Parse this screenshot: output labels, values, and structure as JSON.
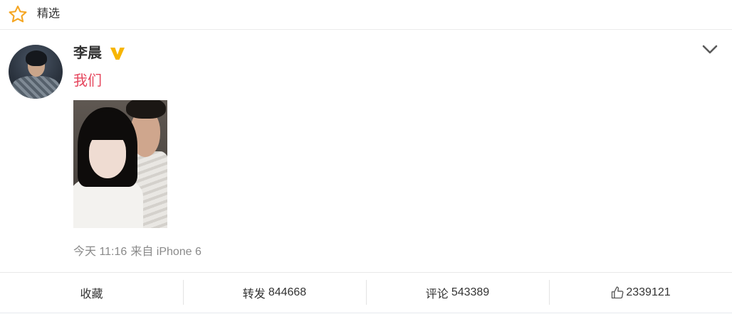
{
  "header": {
    "icon": "star-outline-icon",
    "title": "精选"
  },
  "post": {
    "author": {
      "name": "李晨",
      "badge_icon": "verified-v-icon"
    },
    "menu_icon": "chevron-down-icon",
    "text": "我们",
    "meta": {
      "time": "今天 11:16",
      "source": "来自 iPhone 6"
    },
    "actions": {
      "favorite": {
        "label": "收藏"
      },
      "repost": {
        "label": "转发",
        "count": "844668"
      },
      "comment": {
        "label": "评论",
        "count": "543389"
      },
      "like": {
        "icon": "thumbs-up-icon",
        "count": "2339121"
      }
    }
  },
  "colors": {
    "accent": "#f5a623",
    "badge": "#f7b500",
    "post_text": "#e5465d",
    "meta_text": "#8a8a8a"
  }
}
